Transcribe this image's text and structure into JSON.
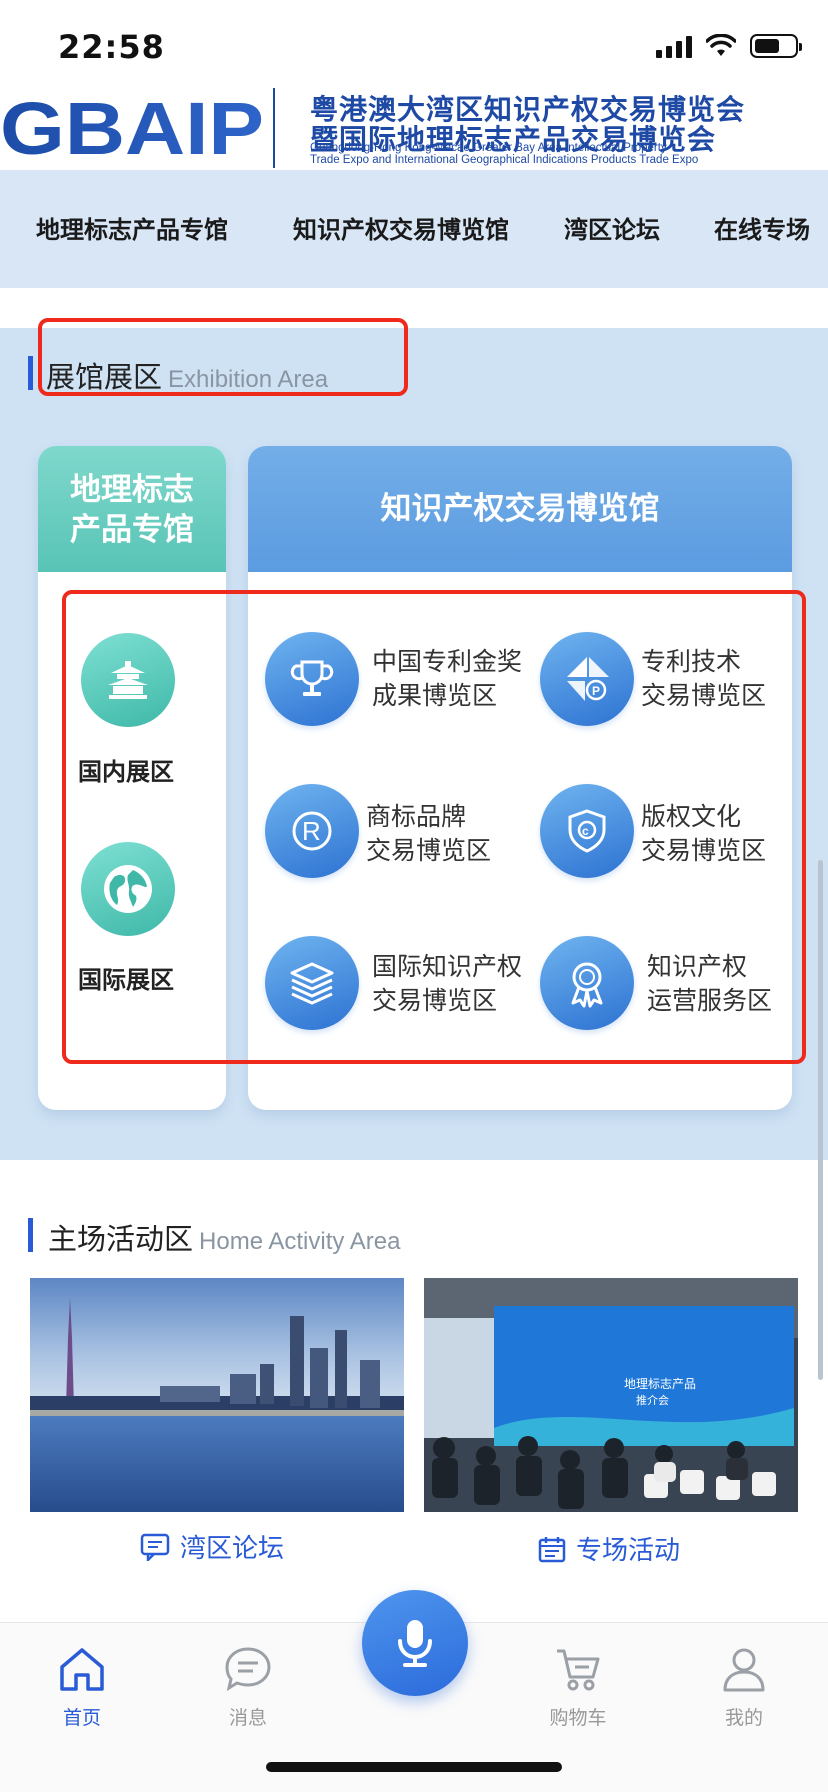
{
  "status_bar": {
    "time": "22:58"
  },
  "header": {
    "logo_text": "GBAIP",
    "title_cn_line1": "粤港澳大湾区知识产权交易博览会",
    "title_cn_line2": "暨国际地理标志产品交易博览会",
    "title_en_line1": "Guangdong-Hong Kong-Macao Greater Bay Area Intellectual Property",
    "title_en_line2": "Trade Expo and International Geographical Indications Products Trade Expo"
  },
  "nav": {
    "items": [
      "地理标志产品专馆",
      "知识产权交易博览馆",
      "湾区论坛",
      "在线专场"
    ]
  },
  "exhibition": {
    "title_cn": "展馆展区",
    "title_en": "Exhibition  Area",
    "left_card": {
      "title": "地理标志产品专馆",
      "title_line1": "地理标志",
      "title_line2": "产品专馆",
      "items": [
        {
          "label": "国内展区",
          "icon": "temple-icon"
        },
        {
          "label": "国际展区",
          "icon": "globe-icon"
        }
      ]
    },
    "right_card": {
      "title": "知识产权交易博览馆",
      "items": [
        {
          "line1": "中国专利金奖",
          "line2": "成果博览区",
          "icon": "trophy-icon"
        },
        {
          "line1": "专利技术",
          "line2": "交易博览区",
          "icon": "patent-icon"
        },
        {
          "line1": "商标品牌",
          "line2": "交易博览区",
          "icon": "registered-icon"
        },
        {
          "line1": "版权文化",
          "line2": "交易博览区",
          "icon": "copyright-icon"
        },
        {
          "line1": "国际知识产权",
          "line2": "交易博览区",
          "icon": "layers-icon"
        },
        {
          "line1": "知识产权",
          "line2": "运营服务区",
          "icon": "award-ribbon-icon"
        }
      ]
    }
  },
  "home_activity": {
    "title_cn": "主场活动区",
    "title_en": "Home Activity Area",
    "cards": [
      {
        "caption": "湾区论坛",
        "icon": "chat-icon"
      },
      {
        "caption": "专场活动",
        "icon": "calendar-icon"
      }
    ],
    "banner_text": "地理标志产品",
    "banner_text2": "推介会"
  },
  "tabbar": {
    "items": [
      {
        "label": "首页",
        "icon": "home-icon",
        "active": true
      },
      {
        "label": "消息",
        "icon": "message-icon",
        "active": false
      },
      {
        "label": "购物车",
        "icon": "cart-icon",
        "active": false
      },
      {
        "label": "我的",
        "icon": "user-icon",
        "active": false
      }
    ],
    "center_icon": "microphone-icon"
  },
  "colors": {
    "primary_blue": "#2a5bd7",
    "teal": "#58c4b6",
    "highlight_red": "#ee2a1c",
    "nav_bg": "#d8e6f5",
    "section_bg": "#cfe2f4"
  }
}
